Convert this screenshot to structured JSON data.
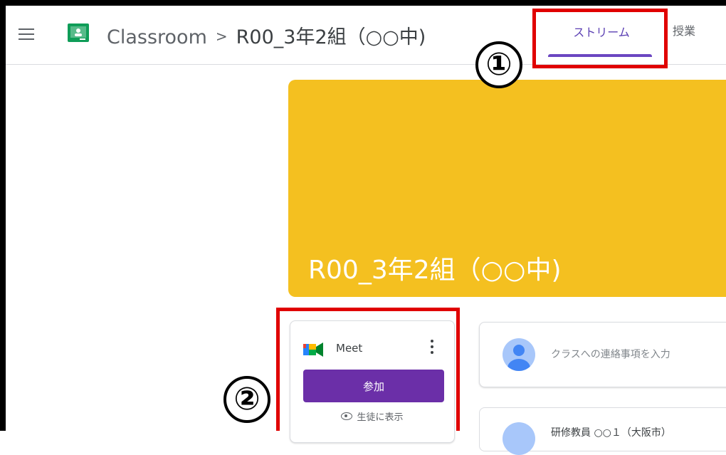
{
  "header": {
    "app_name": "Classroom",
    "separator": ">",
    "class_name": "R00_3年2組（○○中)"
  },
  "tabs": [
    {
      "label": "ストリーム",
      "active": true
    },
    {
      "label": "授業",
      "active": false
    }
  ],
  "annotations": {
    "marker_1": "①",
    "marker_2": "②"
  },
  "banner": {
    "title": "R00_3年2組（○○中)",
    "color": "#f4c020"
  },
  "meet": {
    "name": "Meet",
    "join_label": "参加",
    "visibility_label": "生徒に表示"
  },
  "announce": {
    "placeholder": "クラスへの連絡事項を入力"
  },
  "post": {
    "text": "研修教員 ○○１（大阪市）"
  },
  "colors": {
    "accent": "#6b2fa8",
    "highlight_box": "#e00000"
  }
}
